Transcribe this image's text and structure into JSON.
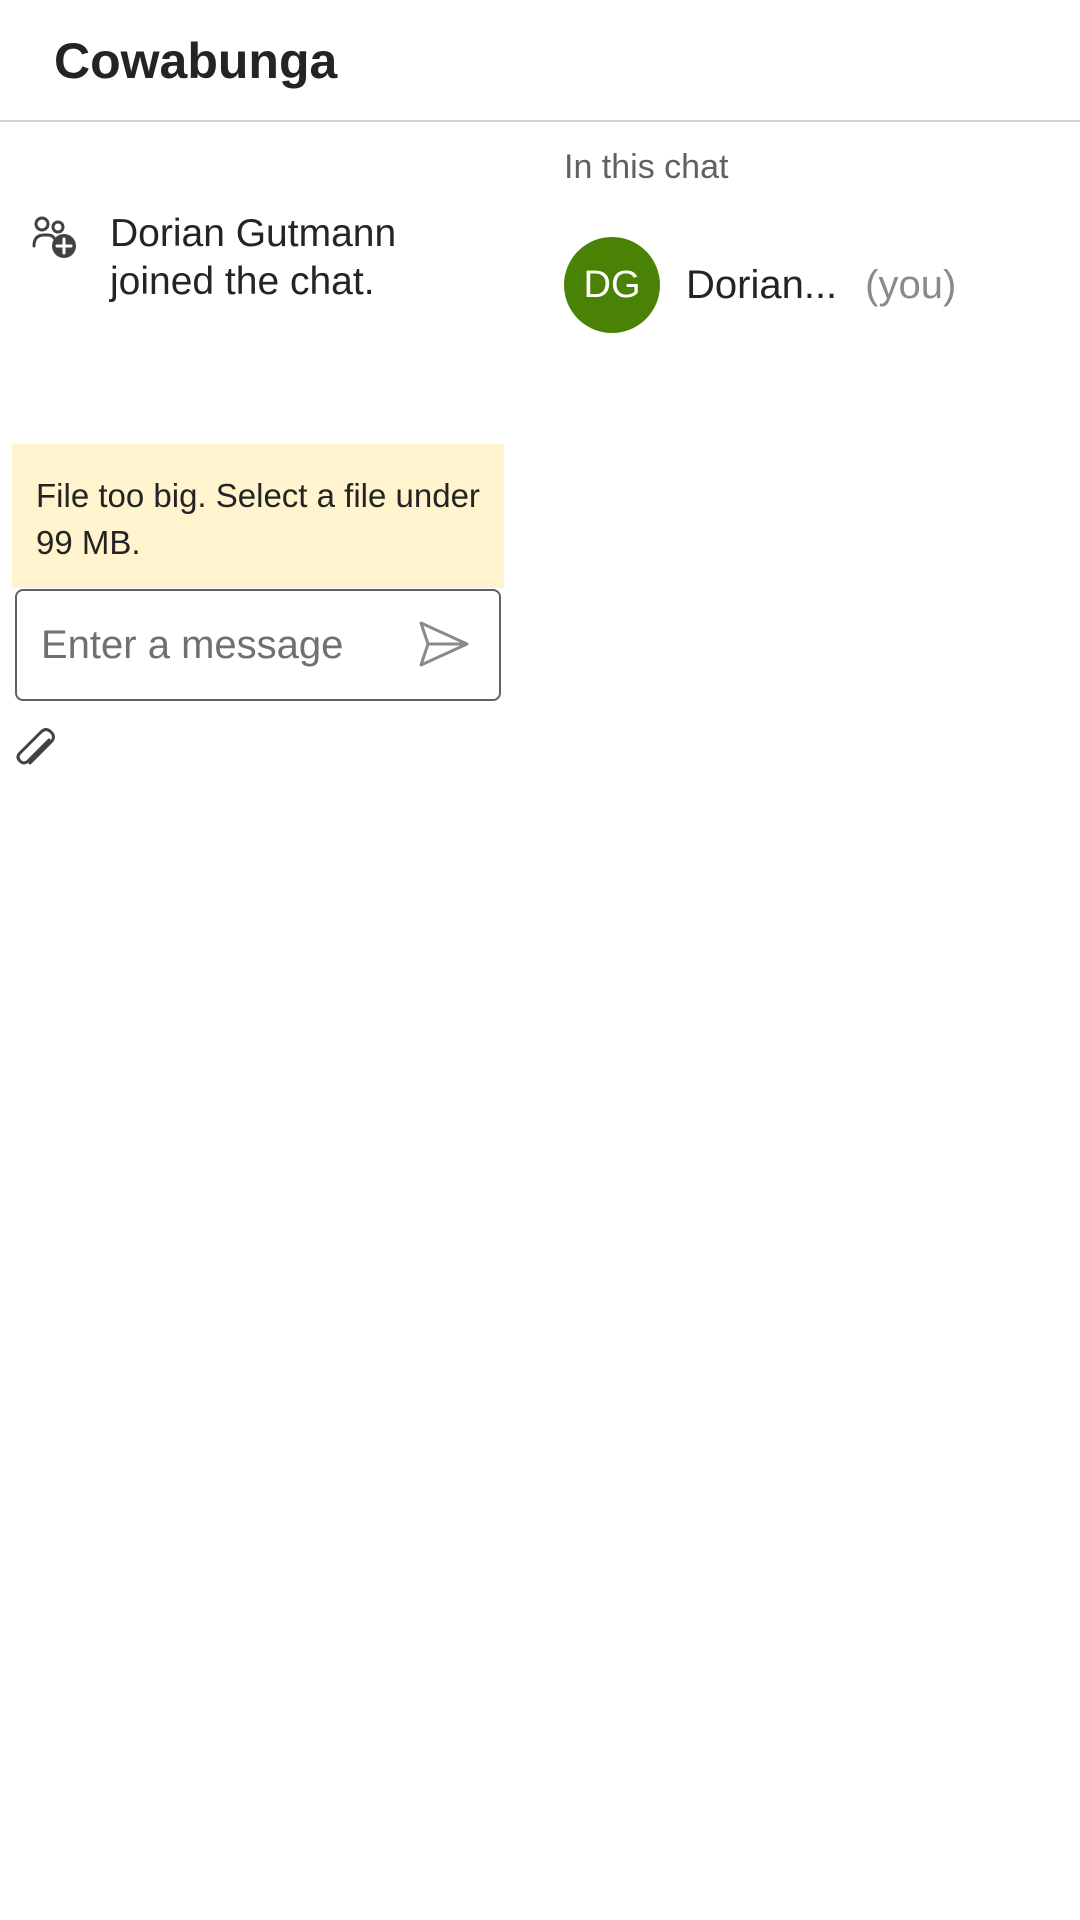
{
  "header": {
    "title": "Cowabunga"
  },
  "chat": {
    "system_message": {
      "icon": "person-add-icon",
      "text": "Dorian Gutmann joined the chat."
    },
    "warning": {
      "text": "File too big. Select a file under 99 MB.",
      "background": "#fff4ce"
    },
    "composer": {
      "placeholder": "Enter a message",
      "value": "",
      "send_icon": "send-icon",
      "attach_icon": "paperclip-icon"
    }
  },
  "participants": {
    "heading": "In this chat",
    "items": [
      {
        "initials": "DG",
        "name": "Dorian...",
        "you_label": "(you)",
        "avatar_color": "#498205"
      }
    ]
  }
}
